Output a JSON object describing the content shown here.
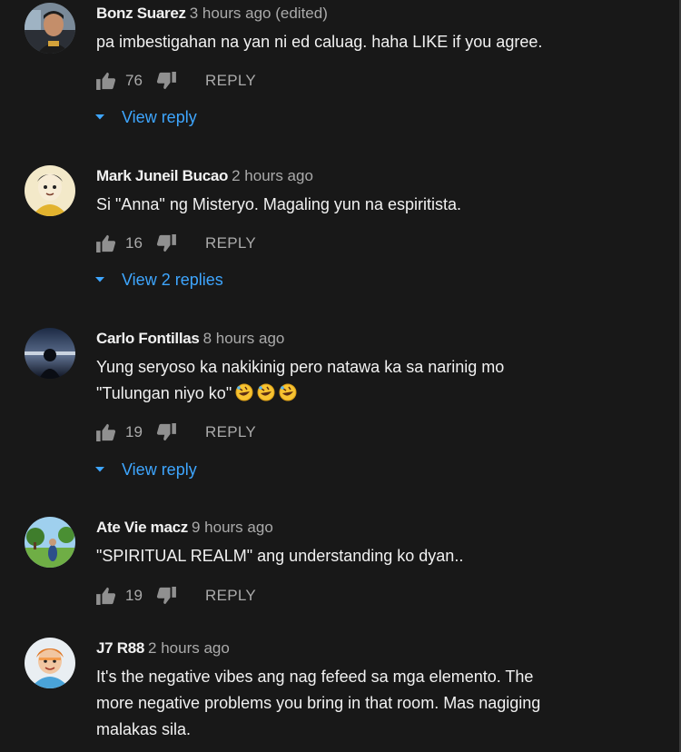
{
  "comments": [
    {
      "author": "Bonz Suarez",
      "time": "3 hours ago (edited)",
      "text": "pa imbestigahan na yan ni ed caluag. haha LIKE if you agree.",
      "likes": "76",
      "reply_label": "REPLY",
      "view_replies": "View reply",
      "avatar_icon": "avatar-man-portrait"
    },
    {
      "author": "Mark Juneil Bucao",
      "time": "2 hours ago",
      "text": "Si \"Anna\" ng Misteryo. Magaling yun na espiritista.",
      "likes": "16",
      "reply_label": "REPLY",
      "view_replies": "View 2 replies",
      "avatar_icon": "avatar-drawn-face"
    },
    {
      "author": "Carlo Fontillas",
      "time": "8 hours ago",
      "text_line1": "Yung seryoso ka nakikinig pero natawa ka sa narinig mo",
      "text_line2": "\"Tulungan niyo ko\"",
      "emojis": [
        "rolling-on-floor-laughing-emoji",
        "rolling-on-floor-laughing-emoji",
        "rolling-on-floor-laughing-emoji"
      ],
      "likes": "19",
      "reply_label": "REPLY",
      "view_replies": "View reply",
      "avatar_icon": "avatar-silhouette-sunset"
    },
    {
      "author": "Ate Vie macz",
      "time": "9 hours ago",
      "text": "\"SPIRITUAL REALM\" ang understanding ko dyan..",
      "likes": "19",
      "reply_label": "REPLY",
      "avatar_icon": "avatar-park-scene"
    },
    {
      "author": "J7 R88",
      "time": "2 hours ago",
      "text_line1": "It's the negative vibes ang nag fefeed sa mga elemento. The",
      "text_line2": "more negative problems you bring in that room. Mas nagiging",
      "text_line3": "malakas sila.",
      "avatar_icon": "avatar-cartoon-boy"
    }
  ],
  "colors": {
    "background": "#181818",
    "text": "#f1f1f1",
    "muted": "#aaaaaa",
    "link": "#3ea6ff"
  }
}
